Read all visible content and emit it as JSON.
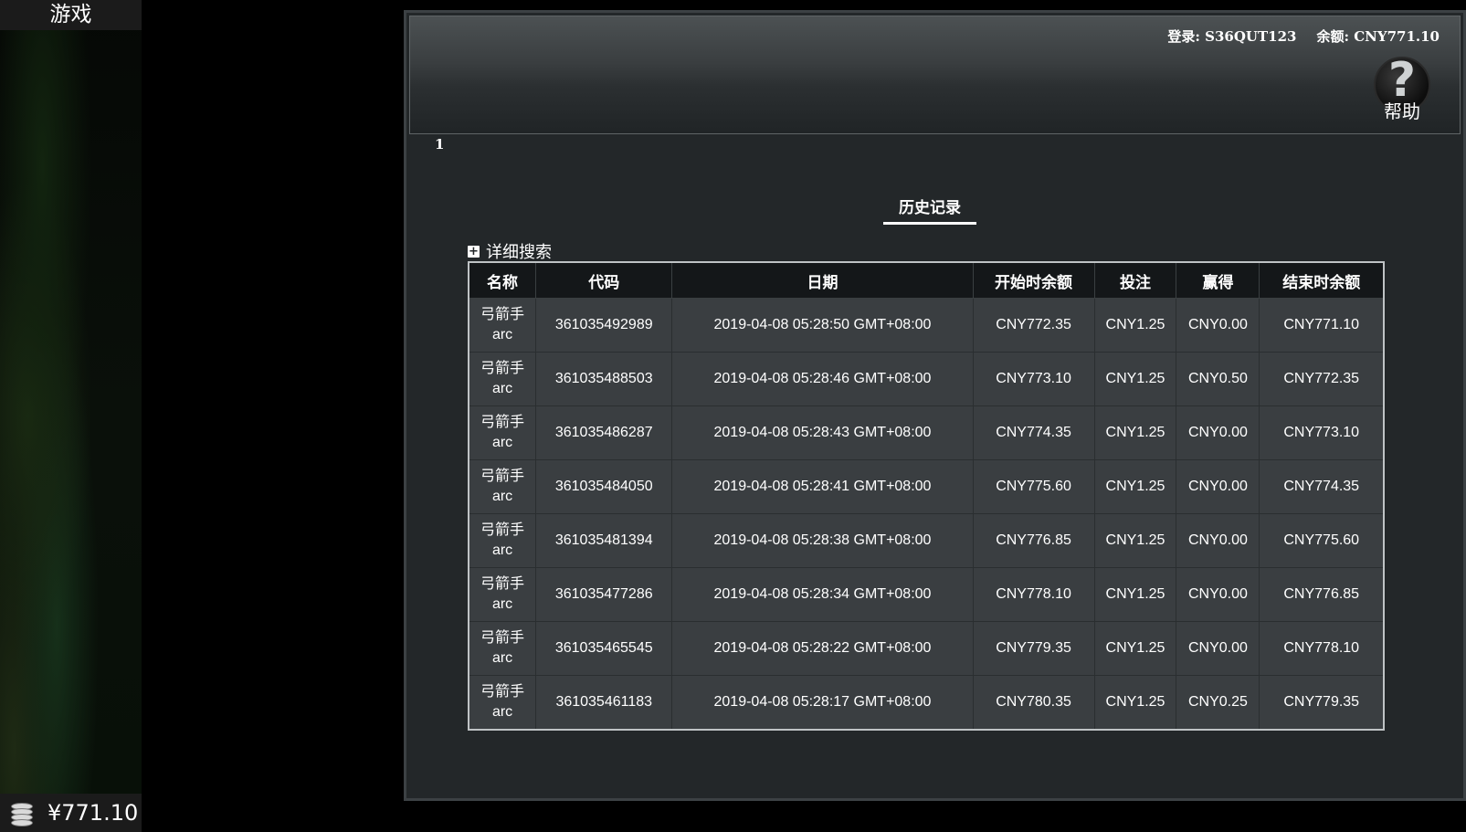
{
  "sidebar": {
    "title": "游戏",
    "balance": "¥771.10"
  },
  "header": {
    "login_label": "登录: S36QUT123",
    "balance_label": "余额: CNY771.10",
    "help_label": "帮助",
    "help_glyph": "?"
  },
  "page_number": "1",
  "section_title": "历史记录",
  "advanced_search": {
    "icon": "plus-box-icon",
    "label": "详细搜索"
  },
  "table": {
    "columns": [
      "名称",
      "代码",
      "日期",
      "开始时余额",
      "投注",
      "赢得",
      "结束时余额"
    ],
    "rows": [
      {
        "name": "弓箭手",
        "name_sub": "arc",
        "code": "361035492989",
        "date": "2019-04-08 05:28:50 GMT+08:00",
        "start": "CNY772.35",
        "bet": "CNY1.25",
        "win": "CNY0.00",
        "end": "CNY771.10"
      },
      {
        "name": "弓箭手",
        "name_sub": "arc",
        "code": "361035488503",
        "date": "2019-04-08 05:28:46 GMT+08:00",
        "start": "CNY773.10",
        "bet": "CNY1.25",
        "win": "CNY0.50",
        "end": "CNY772.35"
      },
      {
        "name": "弓箭手",
        "name_sub": "arc",
        "code": "361035486287",
        "date": "2019-04-08 05:28:43 GMT+08:00",
        "start": "CNY774.35",
        "bet": "CNY1.25",
        "win": "CNY0.00",
        "end": "CNY773.10"
      },
      {
        "name": "弓箭手",
        "name_sub": "arc",
        "code": "361035484050",
        "date": "2019-04-08 05:28:41 GMT+08:00",
        "start": "CNY775.60",
        "bet": "CNY1.25",
        "win": "CNY0.00",
        "end": "CNY774.35"
      },
      {
        "name": "弓箭手",
        "name_sub": "arc",
        "code": "361035481394",
        "date": "2019-04-08 05:28:38 GMT+08:00",
        "start": "CNY776.85",
        "bet": "CNY1.25",
        "win": "CNY0.00",
        "end": "CNY775.60"
      },
      {
        "name": "弓箭手",
        "name_sub": "arc",
        "code": "361035477286",
        "date": "2019-04-08 05:28:34 GMT+08:00",
        "start": "CNY778.10",
        "bet": "CNY1.25",
        "win": "CNY0.00",
        "end": "CNY776.85"
      },
      {
        "name": "弓箭手",
        "name_sub": "arc",
        "code": "361035465545",
        "date": "2019-04-08 05:28:22 GMT+08:00",
        "start": "CNY779.35",
        "bet": "CNY1.25",
        "win": "CNY0.00",
        "end": "CNY778.10"
      },
      {
        "name": "弓箭手",
        "name_sub": "arc",
        "code": "361035461183",
        "date": "2019-04-08 05:28:17 GMT+08:00",
        "start": "CNY780.35",
        "bet": "CNY1.25",
        "win": "CNY0.25",
        "end": "CNY779.35"
      }
    ]
  },
  "colors": {
    "panel_bg": "#232729",
    "header_cell_bg": "#141719",
    "row_bg": "#3a3e41",
    "text": "#ffffff"
  }
}
